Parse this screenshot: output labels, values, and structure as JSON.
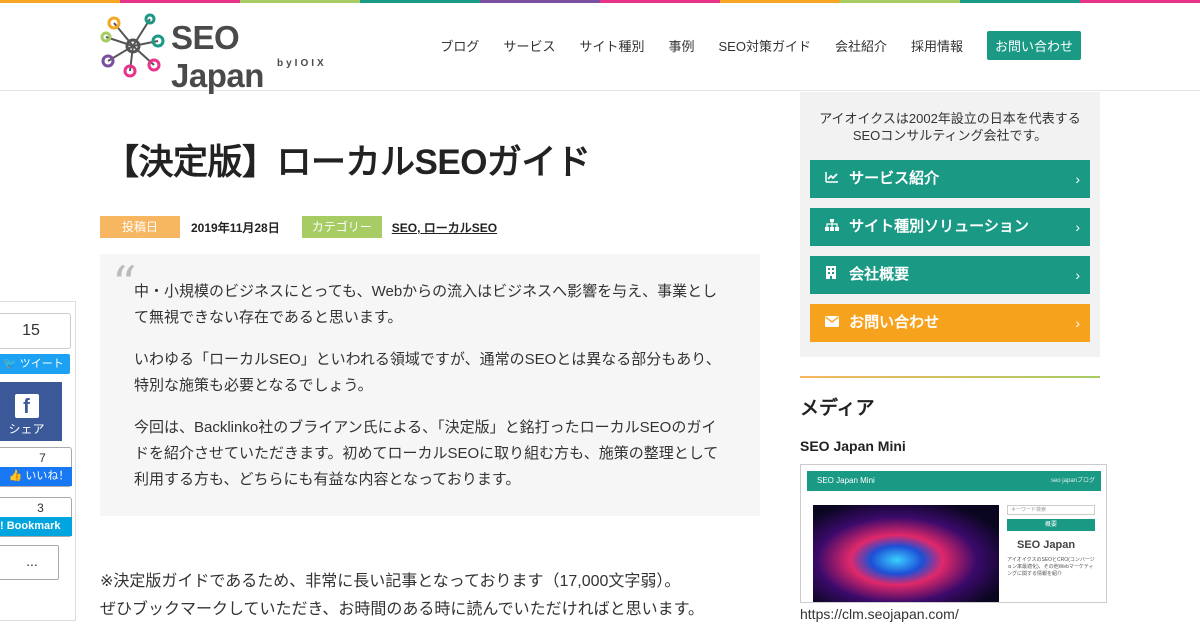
{
  "colors": {
    "rainbow": [
      "#f5a623",
      "#e8338b",
      "#a6cc63",
      "#1a9985",
      "#7b4fa0",
      "#e8338b",
      "#f5a623",
      "#a6cc63",
      "#1a9985",
      "#e8338b"
    ],
    "accent_teal": "#1a9985",
    "accent_orange": "#f7a21d",
    "posted_badge": "#f7b660",
    "category_badge": "#a6cc63"
  },
  "header": {
    "logo_text": "SEO Japan",
    "logo_sub": "byIOIX",
    "nav": [
      "ブログ",
      "サービス",
      "サイト種別",
      "事例",
      "SEO対策ガイド",
      "会社紹介",
      "採用情報"
    ],
    "cta": "お問い合わせ"
  },
  "article": {
    "title": "【決定版】ローカルSEOガイド",
    "posted_label": "投稿日",
    "date": "2019年11月28日",
    "category_label": "カテゴリー",
    "categories": "SEO, ローカルSEO",
    "quote_mark": "“",
    "quote": [
      "中・小規模のビジネスにとっても、Webからの流入はビジネスへ影響を与え、事業として無視できない存在であると思います。",
      "いわゆる「ローカルSEO」といわれる領域ですが、通常のSEOとは異なる部分もあり、特別な施策も必要となるでしょう。",
      "今回は、Backlinko社のブライアン氏による、「決定版」と銘打ったローカルSEOのガイドを紹介させていただきます。初めてローカルSEOに取り組む方も、施策の整理として利用する方も、どちらにも有益な内容となっております。"
    ],
    "note_line1": "※決定版ガイドであるため、非常に長い記事となっております（17,000文字弱）。",
    "note_line2": "ぜひブックマークしていただき、お時間のある時に読んでいただければと思います。"
  },
  "share": {
    "count": "15",
    "tweet_label": "ツイート",
    "fb_icon": "f",
    "fb_label": "シェア",
    "like_count": "7",
    "like_label": "いいね！",
    "hb_count": "3",
    "hb_label": "Bookmark",
    "more_label": "..."
  },
  "sidebar": {
    "intro_line1": "アイオイクスは2002年設立の日本を代表する",
    "intro_line2": "SEOコンサルティング会社です。",
    "buttons": [
      {
        "icon": "chart-line-icon",
        "glyph": "📈",
        "label": "サービス紹介"
      },
      {
        "icon": "sitemap-icon",
        "glyph": "⊞",
        "label": "サイト種別ソリューション"
      },
      {
        "icon": "building-icon",
        "glyph": "▥",
        "label": "会社概要"
      },
      {
        "icon": "envelope-icon",
        "glyph": "✉",
        "label": "お問い合わせ"
      }
    ],
    "chevron": "›",
    "media_heading": "メディア",
    "media_title": "SEO Japan Mini",
    "media_url": "https://clm.seojapan.com/",
    "thumb": {
      "bar_title": "SEO Japan Mini",
      "bar_tag": "seo japanブログ",
      "search": "キーワード検索",
      "head": "概要",
      "logo": "SEO Japan",
      "text": "アイオイクスのSEOとCRO(コンバージョン率最適化)、その他Webマーケティングに関する情報を紹介"
    }
  }
}
